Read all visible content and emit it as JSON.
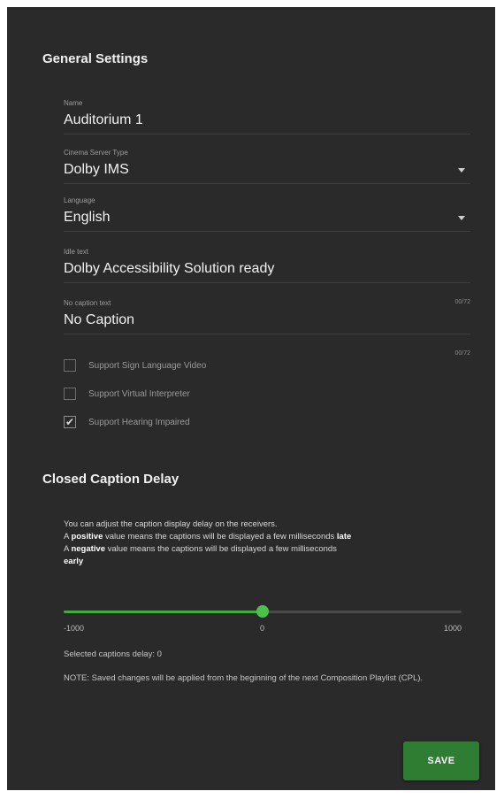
{
  "general": {
    "title": "General Settings",
    "name": {
      "label": "Name",
      "value": "Auditorium 1"
    },
    "server_type": {
      "label": "Cinema Server Type",
      "value": "Dolby IMS"
    },
    "language": {
      "label": "Language",
      "value": "English"
    },
    "idle_text": {
      "label": "Idle text",
      "value": "Dolby Accessibility Solution ready"
    },
    "no_caption_text": {
      "label": "No caption text",
      "value": "No Caption"
    },
    "counters": [
      "00/72",
      "00/72"
    ],
    "checkboxes": [
      {
        "label": "Support Sign Language Video",
        "checked": false
      },
      {
        "label": "Support Virtual Interpreter",
        "checked": false
      },
      {
        "label": "Support Hearing Impaired",
        "checked": true
      }
    ]
  },
  "delay": {
    "title": "Closed Caption Delay",
    "line1": "You can adjust the caption display delay on the receivers.",
    "line2_pre": "A ",
    "line2_bold": "positive",
    "line2_mid": " value means the captions will be displayed a few milliseconds ",
    "line2_end": "late",
    "line3_pre": "A ",
    "line3_bold": "negative",
    "line3_mid": " value means the captions will be displayed a few milliseconds",
    "line3_end": "early",
    "slider": {
      "min": -1000,
      "max": 1000,
      "value": 0
    },
    "tick_min": "-1000",
    "tick_mid": "0",
    "tick_max": "1000",
    "selected": "Selected captions delay: 0",
    "note": "NOTE: Saved changes will be applied from the beginning of the next Composition Playlist (CPL)."
  },
  "actions": {
    "save": "SAVE"
  },
  "colors": {
    "panel": "#2a2a2a",
    "accent": "#3fae3f",
    "button": "#2e7d32"
  }
}
